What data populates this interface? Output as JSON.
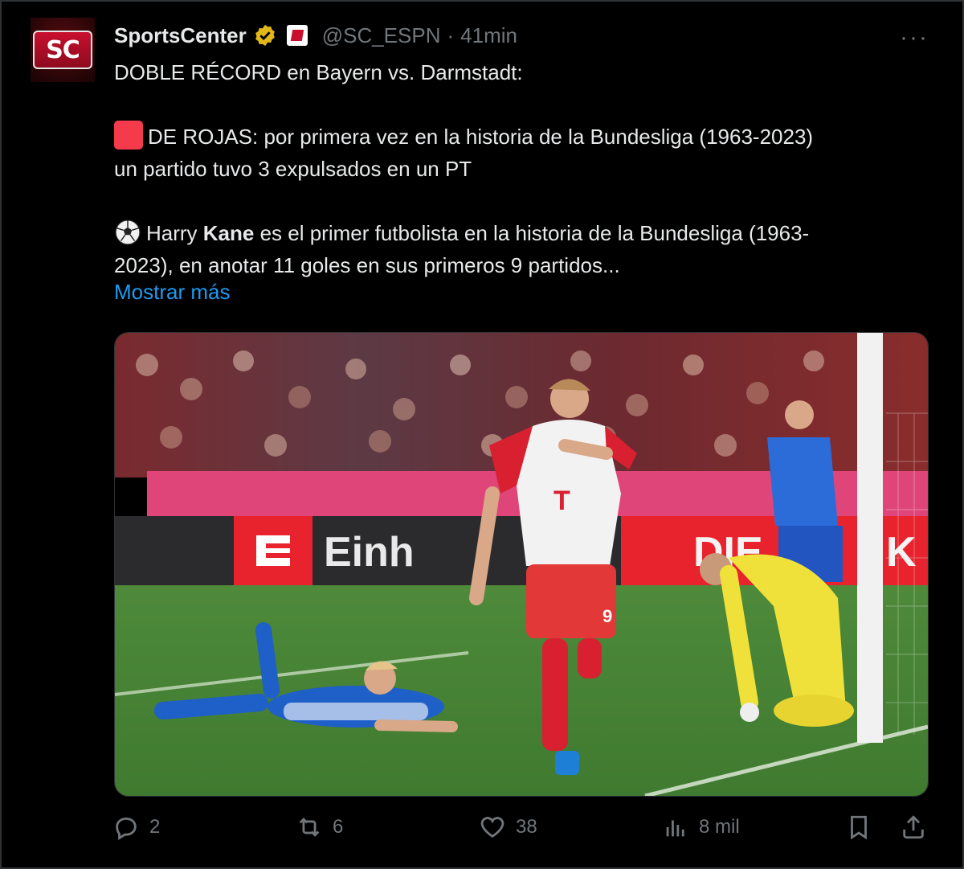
{
  "tweet": {
    "avatar_text": "SC",
    "display_name": "SportsCenter",
    "handle": "@SC_ESPN",
    "separator": "·",
    "time": "41min",
    "more_label": "···",
    "line1": "DOBLE RÉCORD en Bayern vs. Darmstadt:",
    "para2_line1": "DE ROJAS: por primera vez en la historia de la Bundesliga (1963-2023)",
    "para2_line2": "un partido tuvo 3 expulsados en un PT",
    "para3_pre": "Harry ",
    "para3_bold": "Kane",
    "para3_post": " es el primer futbolista en la historia de la Bundesliga (1963-",
    "para3_line2": "2023), en anotar 11 goles en sus primeros 9 partidos...",
    "show_more": "Mostrar más"
  },
  "media": {
    "alt_icon": "soccer-celebration-photo",
    "board_text_1": "Einh",
    "board_text_2": "DIE",
    "board_text_3": "K",
    "jersey_number": "9"
  },
  "actions": {
    "replies": "2",
    "retweets": "6",
    "likes": "38",
    "views": "8 mil"
  },
  "colors": {
    "background": "#000000",
    "text": "#e7e9ea",
    "muted": "#71767b",
    "link": "#1d9bf0",
    "verified": "#e2b719",
    "red_square": "#f53a4c"
  }
}
